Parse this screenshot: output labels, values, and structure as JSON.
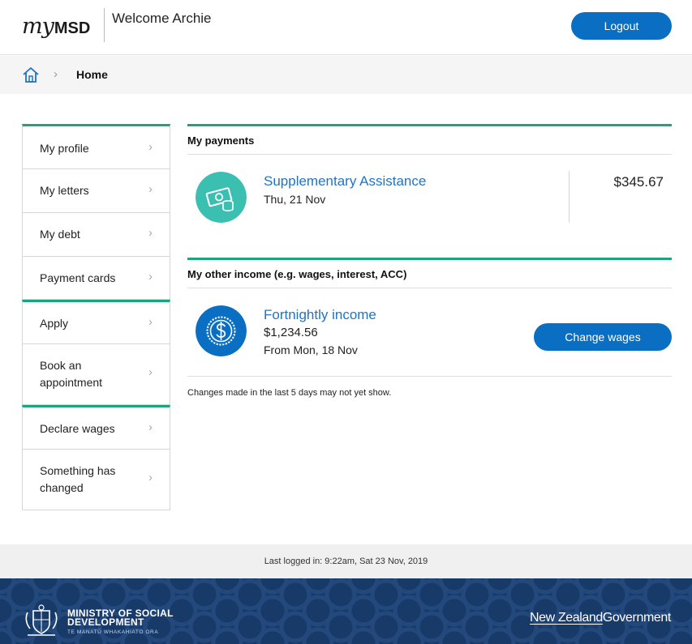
{
  "header": {
    "logo_my": "my",
    "logo_msd": "MSD",
    "welcome": "Welcome Archie",
    "logout_label": "Logout"
  },
  "breadcrumb": {
    "separator": "›",
    "current": "Home"
  },
  "sidebar": {
    "items": [
      {
        "label": "My profile"
      },
      {
        "label": "My letters"
      },
      {
        "label": "My debt"
      },
      {
        "label": "Payment cards"
      },
      {
        "label": "Apply"
      },
      {
        "label": "Book an appointment"
      },
      {
        "label": "Declare wages"
      },
      {
        "label": "Something has changed"
      }
    ],
    "chevron": "›"
  },
  "payments": {
    "title": "My payments",
    "item": {
      "name": "Supplementary Assistance",
      "date": "Thu, 21 Nov",
      "amount": "$345.67",
      "icon": "money-coins-icon"
    }
  },
  "other_income": {
    "title": "My other income (e.g. wages, interest, ACC)",
    "item": {
      "name": "Fortnightly income",
      "amount": "$1,234.56",
      "from": "From Mon, 18 Nov",
      "icon": "dollar-coin-icon"
    },
    "change_button": "Change wages",
    "note": "Changes made in the last 5 days may not yet show."
  },
  "footer": {
    "last_logged_in": "Last logged in: 9:22am, Sat 23 Nov, 2019",
    "ministry_line1": "MINISTRY OF SOCIAL",
    "ministry_line2": "DEVELOPMENT",
    "ministry_sub": "TE MANATŪ WHAKAHIATO ORA",
    "nzgov_part1": "New Zealand",
    "nzgov_part2": "Government"
  },
  "colors": {
    "accent_green": "#1aa57a",
    "button_blue": "#0a6fc2",
    "link_blue": "#1f74c4",
    "teal_icon": "#3bbfb0",
    "footer_navy": "#183a69"
  }
}
